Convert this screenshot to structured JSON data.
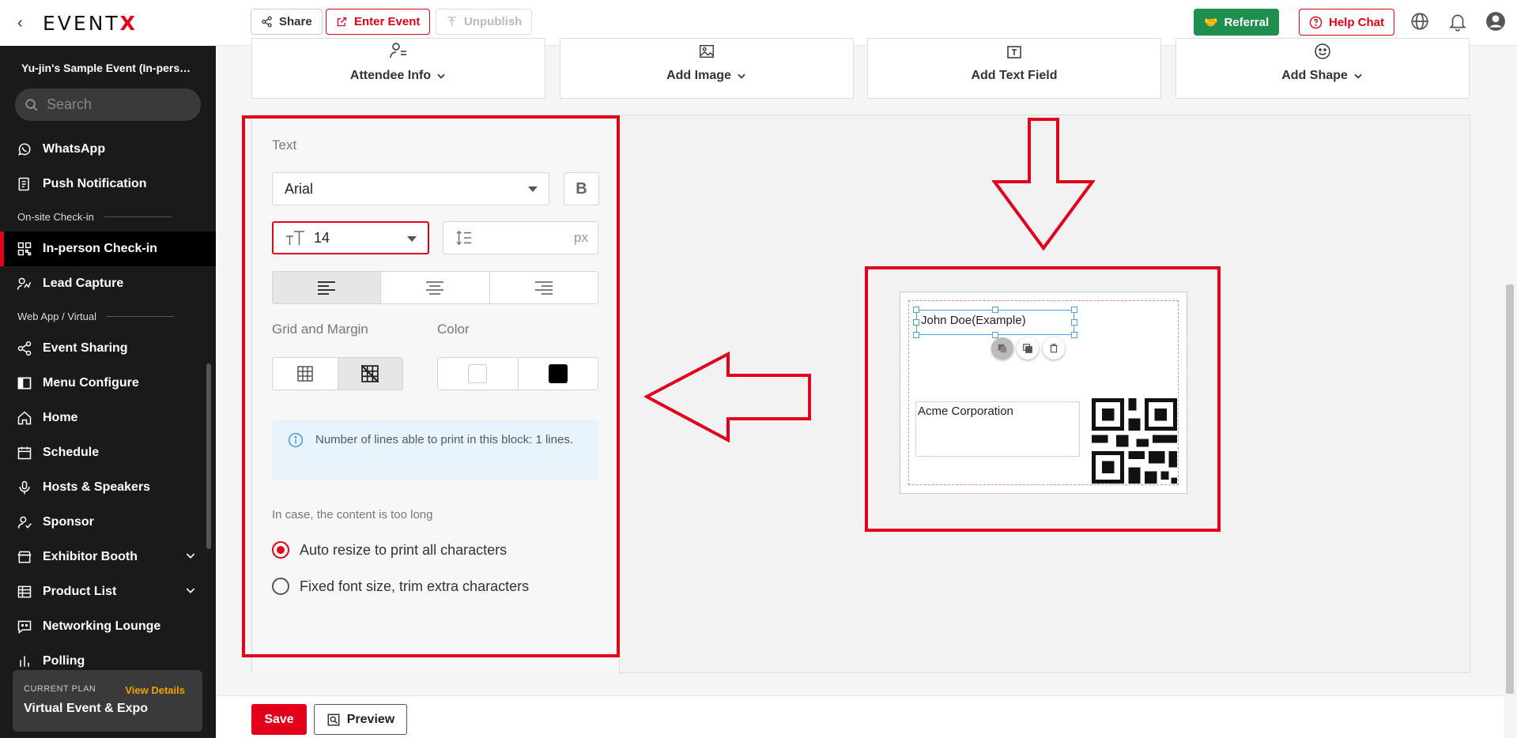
{
  "sidebar": {
    "logo": "EVENT",
    "logo_x": "X",
    "event_name": "Yu-jin's Sample Event (In-person)",
    "search_placeholder": "Search",
    "items": {
      "whatsapp": "WhatsApp",
      "push": "Push Notification",
      "section_onsite": "On-site Check-in",
      "checkin": "In-person Check-in",
      "lead": "Lead Capture",
      "section_web": "Web App / Virtual",
      "sharing": "Event Sharing",
      "menu": "Menu Configure",
      "home": "Home",
      "schedule": "Schedule",
      "hosts": "Hosts & Speakers",
      "sponsor": "Sponsor",
      "exhibitor": "Exhibitor Booth",
      "product": "Product List",
      "networking": "Networking Lounge",
      "polling": "Polling"
    },
    "plan": {
      "label": "CURRENT PLAN",
      "link": "View Details",
      "name": "Virtual Event & Expo"
    }
  },
  "topbar": {
    "share": "Share",
    "enter_event": "Enter Event",
    "unpublish": "Unpublish",
    "referral": "Referral",
    "help_chat": "Help Chat"
  },
  "tools": {
    "attendee": "Attendee Info",
    "image": "Add Image",
    "text": "Add Text Field",
    "shape": "Add Shape"
  },
  "panel": {
    "text_label": "Text",
    "font": "Arial",
    "bold": "B",
    "font_size": "14",
    "line_unit": "px",
    "grid_label": "Grid and Margin",
    "color_label": "Color",
    "info": "Number of lines able to print in this block: 1 lines.",
    "overflow_label": "In case, the content is too long",
    "opt_auto": "Auto resize to print all characters",
    "opt_fixed": "Fixed font size, trim extra characters"
  },
  "badge": {
    "name": "John Doe(Example)",
    "company": "Acme Corporation"
  },
  "footer": {
    "save": "Save",
    "preview": "Preview"
  },
  "colors": {
    "accent": "#e2001a",
    "referral": "#1f8f4e",
    "plan_link": "#f0a000"
  }
}
